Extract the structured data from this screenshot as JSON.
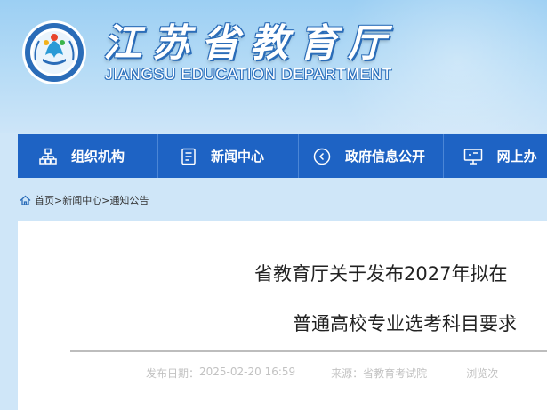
{
  "header": {
    "title": "江苏省教育厅",
    "subtitle": "JIANGSU EDUCATION DEPARTMENT"
  },
  "nav": {
    "items": [
      {
        "label": "组织机构",
        "icon": "org-chart-icon"
      },
      {
        "label": "新闻中心",
        "icon": "document-icon"
      },
      {
        "label": "政府信息公开",
        "icon": "circle-arrow-icon"
      },
      {
        "label": "网上办",
        "icon": "monitor-icon"
      }
    ]
  },
  "breadcrumb": {
    "home": "首页",
    "sep": ">",
    "level2": "新闻中心",
    "level3": "通知公告"
  },
  "article": {
    "title_line1": "省教育厅关于发布2027年拟在",
    "title_line2": "普通高校专业选考科目要求",
    "meta": {
      "date_label": "发布日期：",
      "date": "2025-02-20 16:59",
      "source_label": "来源：",
      "source": "省教育考试院",
      "views_label": "浏览次"
    }
  },
  "colors": {
    "nav_bg": "#1e63c4",
    "header_bg": "#a8d5f5",
    "meta_text": "#c2c2c2"
  }
}
